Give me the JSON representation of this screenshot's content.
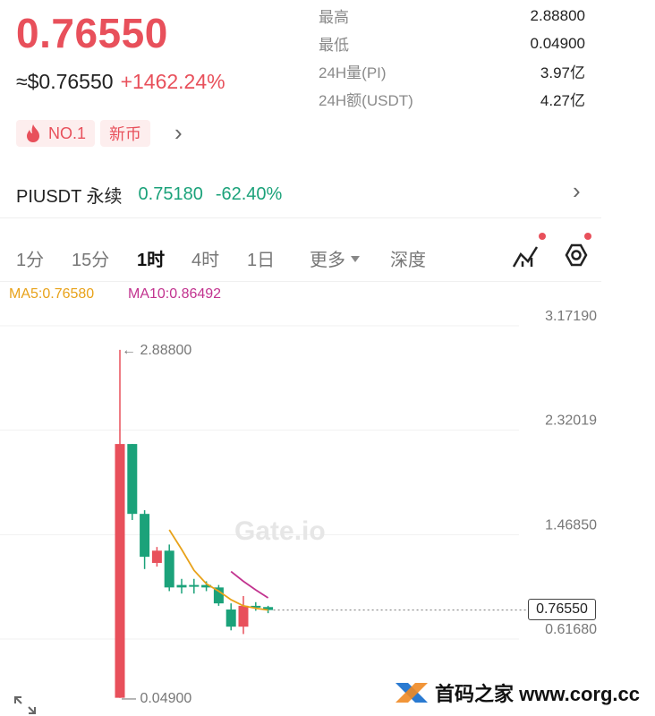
{
  "header": {
    "last_price": "0.76550",
    "usd_price": "≈$0.76550",
    "change": "+1462.24%",
    "badges": {
      "no1": "NO.1",
      "new": "新币"
    }
  },
  "stats": [
    {
      "label": "最高",
      "value": "2.88800"
    },
    {
      "label": "最低",
      "value": "0.04900"
    },
    {
      "label": "24H量(PI)",
      "value": "3.97亿"
    },
    {
      "label": "24H额(USDT)",
      "value": "4.27亿"
    }
  ],
  "contract": {
    "name": "PIUSDT 永续",
    "price": "0.75180",
    "change": "-62.40%"
  },
  "tabs": [
    "1分",
    "15分",
    "1时",
    "4时",
    "1日",
    "更多",
    "深度"
  ],
  "active_tab": "1时",
  "indicators": {
    "ma5": "MA5:0.76580",
    "ma10": "MA10:0.86492"
  },
  "colors": {
    "up": "#1ba27a",
    "down": "#e8505b",
    "ma5": "#e8a21a",
    "ma10": "#c2338f"
  },
  "chart_data": {
    "type": "candlestick",
    "y_ticks": [
      "3.17190",
      "2.32019",
      "1.46850",
      "0.61680"
    ],
    "high_annotation": "← 2.88800",
    "low_annotation": "— 0.04900",
    "current_price_label": "0.76550",
    "ylim": [
      0.0,
      3.4
    ],
    "candles": [
      {
        "open": 0.05,
        "close": 2.12,
        "high": 2.888,
        "low": 0.049
      },
      {
        "open": 2.12,
        "close": 1.55,
        "high": 2.12,
        "low": 1.5
      },
      {
        "open": 1.55,
        "close": 1.2,
        "high": 1.58,
        "low": 1.1
      },
      {
        "open": 1.15,
        "close": 1.25,
        "high": 1.28,
        "low": 1.12
      },
      {
        "open": 1.25,
        "close": 0.95,
        "high": 1.3,
        "low": 0.92
      },
      {
        "open": 0.97,
        "close": 0.95,
        "high": 1.02,
        "low": 0.9
      },
      {
        "open": 0.97,
        "close": 0.96,
        "high": 1.02,
        "low": 0.9
      },
      {
        "open": 0.97,
        "close": 0.95,
        "high": 1.0,
        "low": 0.92
      },
      {
        "open": 0.95,
        "close": 0.82,
        "high": 0.97,
        "low": 0.8
      },
      {
        "open": 0.77,
        "close": 0.63,
        "high": 0.82,
        "low": 0.6
      },
      {
        "open": 0.63,
        "close": 0.8,
        "high": 0.88,
        "low": 0.57
      },
      {
        "open": 0.8,
        "close": 0.8,
        "high": 0.83,
        "low": 0.76
      },
      {
        "open": 0.79,
        "close": 0.7655,
        "high": 0.8,
        "low": 0.74
      }
    ],
    "ma5": [
      null,
      null,
      null,
      null,
      1.42,
      1.26,
      1.09,
      0.98,
      0.92,
      0.85,
      0.8,
      0.78,
      0.7658
    ],
    "ma10": [
      null,
      null,
      null,
      null,
      null,
      null,
      null,
      null,
      null,
      1.08,
      1.0,
      0.93,
      0.86492
    ]
  },
  "footer": {
    "site": "首码之家 www.corg.cc"
  }
}
